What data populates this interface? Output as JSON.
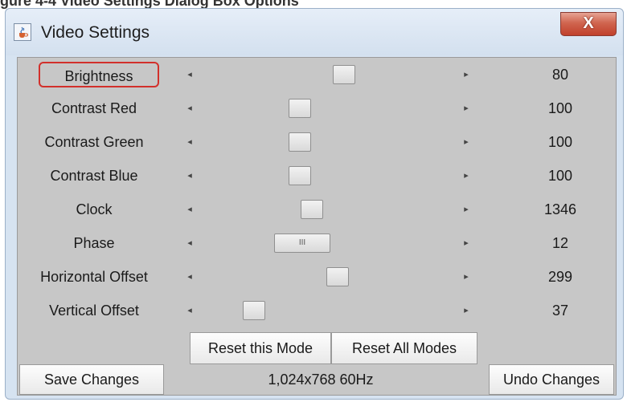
{
  "caption_fragment": "gure 4-4  Video Settings Dialog Box Options",
  "window": {
    "title": "Video Settings",
    "close_glyph": "X",
    "app_icon": "java-cup-icon"
  },
  "arrows": {
    "left_glyph": "◂",
    "right_glyph": "▸"
  },
  "sliders": [
    {
      "label": "Brightness",
      "value": "80",
      "position": 0.57,
      "highlighted": true
    },
    {
      "label": "Contrast Red",
      "value": "100",
      "position": 0.38
    },
    {
      "label": "Contrast Green",
      "value": "100",
      "position": 0.38
    },
    {
      "label": "Contrast Blue",
      "value": "100",
      "position": 0.38
    },
    {
      "label": "Clock",
      "value": "1346",
      "position": 0.43
    },
    {
      "label": "Phase",
      "value": "12",
      "position": 0.37,
      "wide_thumb": true,
      "thumb_grip": "III"
    },
    {
      "label": "Horizontal Offset",
      "value": "299",
      "position": 0.54
    },
    {
      "label": "Vertical Offset",
      "value": "37",
      "position": 0.18
    }
  ],
  "buttons": {
    "reset_mode": "Reset this Mode",
    "reset_all": "Reset All Modes",
    "save": "Save Changes",
    "undo": "Undo Changes"
  },
  "status": "1,024x768 60Hz",
  "colors": {
    "highlight_border": "#d2302b",
    "panel": "#c7c7c7",
    "close_button": "#c1402b"
  }
}
